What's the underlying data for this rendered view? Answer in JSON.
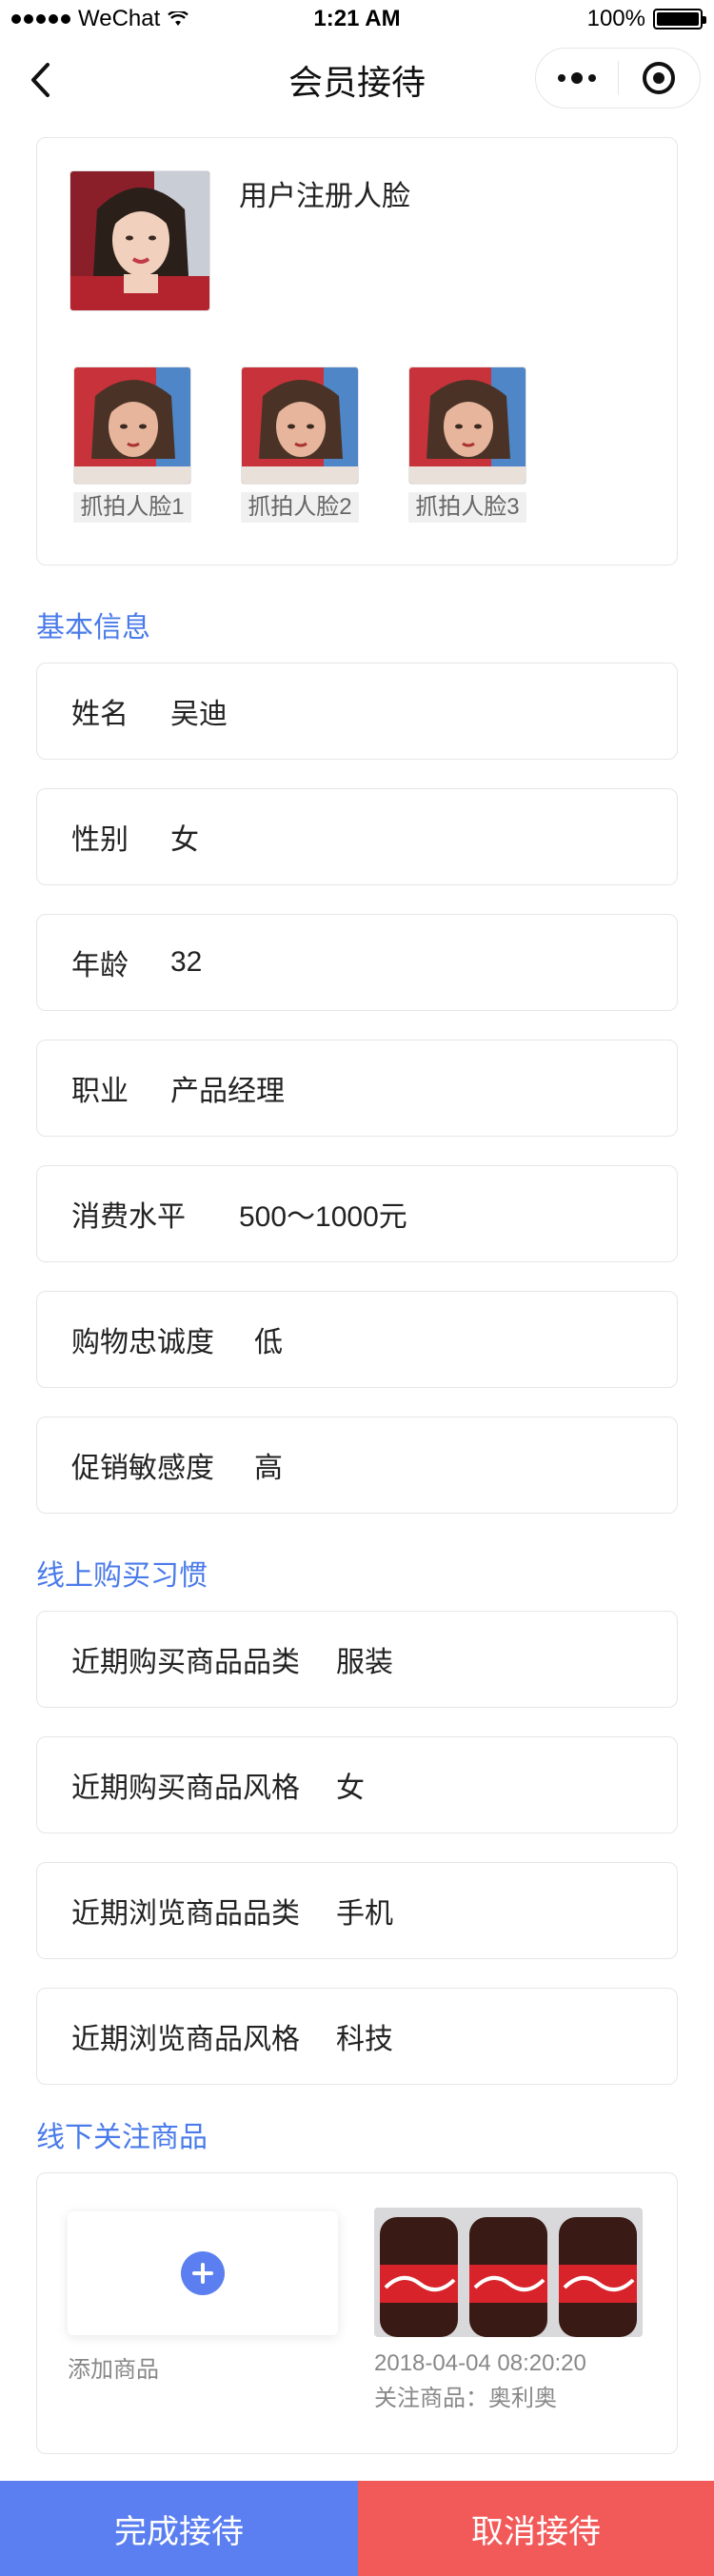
{
  "status_bar": {
    "carrier": "WeChat",
    "time": "1:21 AM",
    "battery": "100%"
  },
  "nav": {
    "title": "会员接待"
  },
  "faces": {
    "registered_label": "用户注册人脸",
    "snapshots": [
      {
        "label": "抓拍人脸1"
      },
      {
        "label": "抓拍人脸2"
      },
      {
        "label": "抓拍人脸3"
      }
    ]
  },
  "basic_info": {
    "title": "基本信息",
    "rows": [
      {
        "key": "姓名",
        "value": "吴迪"
      },
      {
        "key": "性别",
        "value": "女"
      },
      {
        "key": "年龄",
        "value": "32"
      },
      {
        "key": "职业",
        "value": "产品经理"
      },
      {
        "key": "消费水平",
        "value": "500～1000元"
      },
      {
        "key": "购物忠诚度",
        "value": "低"
      },
      {
        "key": "促销敏感度",
        "value": "高"
      }
    ]
  },
  "online_habits": {
    "title": "线上购买习惯",
    "rows": [
      {
        "key": "近期购买商品品类",
        "value": "服装"
      },
      {
        "key": "近期购买商品风格",
        "value": "女"
      },
      {
        "key": "近期浏览商品品类",
        "value": "手机"
      },
      {
        "key": "近期浏览商品风格",
        "value": "科技"
      }
    ]
  },
  "offline_products": {
    "title": "线下关注商品",
    "add_label": "添加商品",
    "product": {
      "time": "2018-04-04 08:20:20",
      "name": "关注商品：奥利奥"
    }
  },
  "bottom": {
    "done": "完成接待",
    "cancel": "取消接待"
  },
  "colors": {
    "accent": "#5b7ff0",
    "danger": "#f25a5a",
    "section_title": "#4a7bea"
  }
}
